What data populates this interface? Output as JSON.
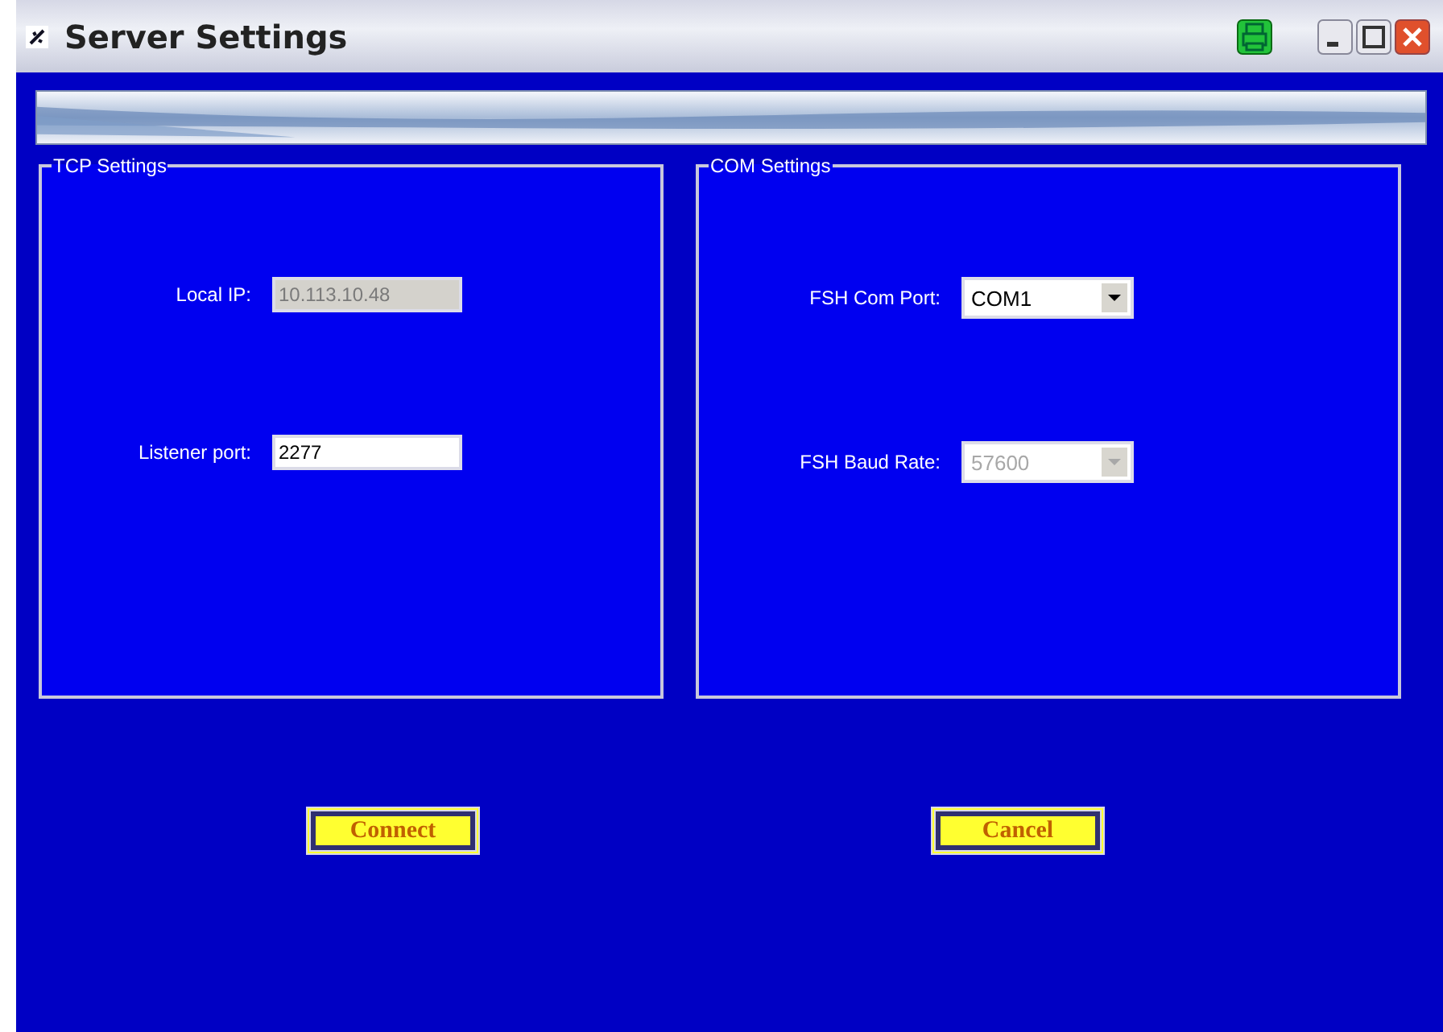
{
  "window": {
    "title": "Server Settings"
  },
  "groups": [
    {
      "title": "TCP Settings",
      "fields": [
        {
          "kind": "text",
          "label": "Local IP:",
          "value": "10.113.10.48",
          "disabled": true
        },
        {
          "kind": "text",
          "label": "Listener port:",
          "value": "2277",
          "disabled": false
        }
      ]
    },
    {
      "title": "COM Settings",
      "fields": [
        {
          "kind": "dropdown",
          "label": "FSH Com Port:",
          "value": "COM1",
          "disabled": false
        },
        {
          "kind": "dropdown",
          "label": "FSH Baud Rate:",
          "value": "57600",
          "disabled": true
        }
      ]
    }
  ],
  "buttons": [
    "Connect",
    "Cancel"
  ]
}
